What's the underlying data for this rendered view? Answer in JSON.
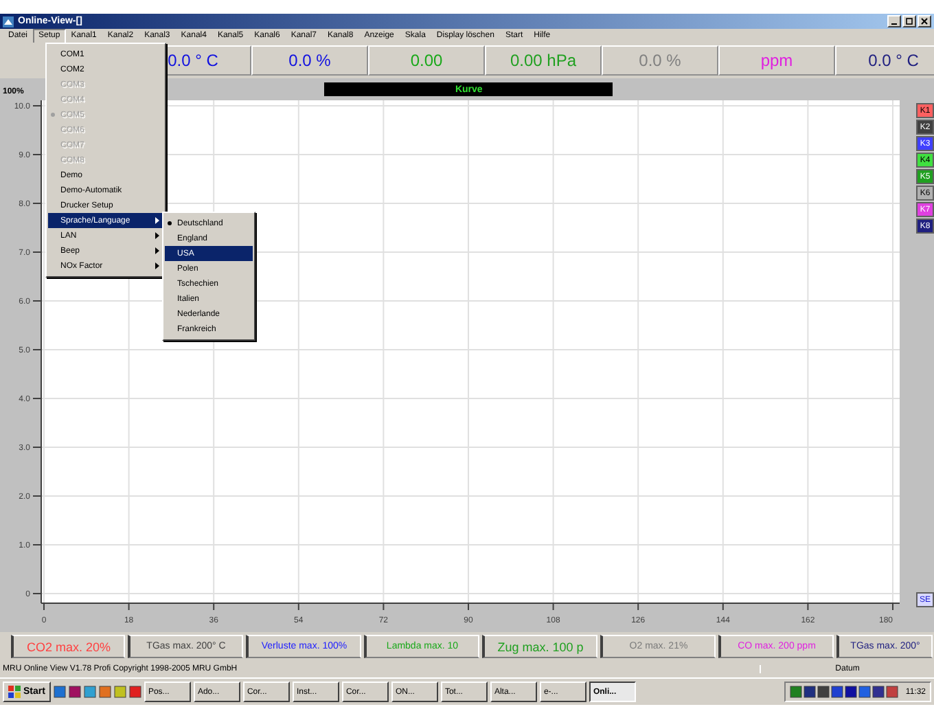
{
  "window": {
    "title": "Online-View-[]"
  },
  "menu_bar": [
    {
      "label": "Datei",
      "selected": false
    },
    {
      "label": "Setup",
      "selected": true
    },
    {
      "label": "Kanal1",
      "selected": false
    },
    {
      "label": "Kanal2",
      "selected": false
    },
    {
      "label": "Kanal3",
      "selected": false
    },
    {
      "label": "Kanal4",
      "selected": false
    },
    {
      "label": "Kanal5",
      "selected": false
    },
    {
      "label": "Kanal6",
      "selected": false
    },
    {
      "label": "Kanal7",
      "selected": false
    },
    {
      "label": "Kanal8",
      "selected": false
    },
    {
      "label": "Anzeige",
      "selected": false
    },
    {
      "label": "Skala",
      "selected": false
    },
    {
      "label": "Display löschen",
      "selected": false
    },
    {
      "label": "Start",
      "selected": false
    },
    {
      "label": "Hilfe",
      "selected": false
    }
  ],
  "readings": [
    {
      "value": "0.0 ° C",
      "color": "#1010e0"
    },
    {
      "value": "0.0 %",
      "color": "#1010e0"
    },
    {
      "value": "0.00",
      "color": "#18a818"
    },
    {
      "value": "0.00 hPa",
      "color": "#20a020"
    },
    {
      "value": "0.0 %",
      "color": "#808080"
    },
    {
      "value": "ppm",
      "color": "#e020e0"
    },
    {
      "value": "0.0 ° C",
      "color": "#202080"
    }
  ],
  "chart": {
    "scale_label": "100%",
    "title": "Kurve",
    "chart_data": {
      "type": "line",
      "grid": true,
      "xlim": [
        0,
        180
      ],
      "ylim": [
        0,
        10
      ],
      "xticks": [
        0,
        18,
        36,
        54,
        72,
        90,
        108,
        126,
        144,
        162,
        180
      ],
      "yticks": [
        {
          "value": 0,
          "label": "0"
        },
        {
          "value": 1,
          "label": "1.0"
        },
        {
          "value": 2,
          "label": "2.0"
        },
        {
          "value": 3,
          "label": "3.0"
        },
        {
          "value": 4,
          "label": "4.0"
        },
        {
          "value": 5,
          "label": "5.0"
        },
        {
          "value": 6,
          "label": "6.0"
        },
        {
          "value": 7,
          "label": "7.0"
        },
        {
          "value": 8,
          "label": "8.0"
        },
        {
          "value": 9,
          "label": "9.0"
        },
        {
          "value": 10,
          "label": "10.0"
        }
      ]
    }
  },
  "channel_buttons": [
    {
      "label": "K1",
      "color": "#ff6060"
    },
    {
      "label": "K2",
      "color": "#404040"
    },
    {
      "label": "K3",
      "color": "#4040ff"
    },
    {
      "label": "K4",
      "color": "#40e040"
    },
    {
      "label": "K5",
      "color": "#20a020"
    },
    {
      "label": "K6",
      "color": "#b0b0b0"
    },
    {
      "label": "K7",
      "color": "#e040e0"
    },
    {
      "label": "K8",
      "color": "#202080"
    }
  ],
  "se_button": "SE",
  "max_values": [
    {
      "label": "CO2 max. 20%",
      "color": "#ff4040"
    },
    {
      "label": "TGas max. 200° C",
      "color": "#404040"
    },
    {
      "label": "Verluste max. 100%",
      "color": "#2020ff"
    },
    {
      "label": "Lambda max. 10",
      "color": "#18a818"
    },
    {
      "label": "Zug max. 100 p",
      "color": "#20a020"
    },
    {
      "label": "O2 max. 21%",
      "color": "#7a7a7a"
    },
    {
      "label": "CO max. 200 ppm",
      "color": "#e020e0"
    },
    {
      "label": "TGas max. 200°",
      "color": "#202080"
    }
  ],
  "status_bar": {
    "text": "MRU Online View V1.78 Profi Copyright 1998-2005 MRU GmbH",
    "date_label": "Datum"
  },
  "setup_menu": [
    {
      "label": "COM1",
      "disabled": false,
      "checked": false,
      "has_submenu": false,
      "selected": false
    },
    {
      "label": "COM2",
      "disabled": false,
      "checked": false,
      "has_submenu": false,
      "selected": false
    },
    {
      "label": "COM3",
      "disabled": true,
      "checked": false,
      "has_submenu": false,
      "selected": false
    },
    {
      "label": "COM4",
      "disabled": true,
      "checked": false,
      "has_submenu": false,
      "selected": false
    },
    {
      "label": "COM5",
      "disabled": true,
      "checked": true,
      "has_submenu": false,
      "selected": false
    },
    {
      "label": "COM6",
      "disabled": true,
      "checked": false,
      "has_submenu": false,
      "selected": false
    },
    {
      "label": "COM7",
      "disabled": true,
      "checked": false,
      "has_submenu": false,
      "selected": false
    },
    {
      "label": "COM8",
      "disabled": true,
      "checked": false,
      "has_submenu": false,
      "selected": false
    },
    {
      "label": "Demo",
      "disabled": false,
      "checked": false,
      "has_submenu": false,
      "selected": false
    },
    {
      "label": "Demo-Automatik",
      "disabled": false,
      "checked": false,
      "has_submenu": false,
      "selected": false
    },
    {
      "label": "Drucker Setup",
      "disabled": false,
      "checked": false,
      "has_submenu": false,
      "selected": false
    },
    {
      "label": "Sprache/Language",
      "disabled": false,
      "checked": false,
      "has_submenu": true,
      "selected": true
    },
    {
      "label": "LAN",
      "disabled": false,
      "checked": false,
      "has_submenu": true,
      "selected": false
    },
    {
      "label": "Beep",
      "disabled": false,
      "checked": false,
      "has_submenu": true,
      "selected": false
    },
    {
      "label": "NOx Factor",
      "disabled": false,
      "checked": false,
      "has_submenu": true,
      "selected": false
    }
  ],
  "language_submenu": [
    {
      "label": "Deutschland",
      "checked": true,
      "selected": false
    },
    {
      "label": "England",
      "checked": false,
      "selected": false
    },
    {
      "label": "USA",
      "checked": false,
      "selected": true
    },
    {
      "label": "Polen",
      "checked": false,
      "selected": false
    },
    {
      "label": "Tschechien",
      "checked": false,
      "selected": false
    },
    {
      "label": "Italien",
      "checked": false,
      "selected": false
    },
    {
      "label": "Nederlande",
      "checked": false,
      "selected": false
    },
    {
      "label": "Frankreich",
      "checked": false,
      "selected": false
    }
  ],
  "taskbar": {
    "start": "Start",
    "clock": "11:32",
    "tasks": [
      {
        "label": "Pos...",
        "selected": false
      },
      {
        "label": "Ado...",
        "selected": false
      },
      {
        "label": "Cor...",
        "selected": false
      },
      {
        "label": "Inst...",
        "selected": false
      },
      {
        "label": "Cor...",
        "selected": false
      },
      {
        "label": "ON...",
        "selected": false
      },
      {
        "label": "Tot...",
        "selected": false
      },
      {
        "label": "Alta...",
        "selected": false
      },
      {
        "label": "e-...",
        "selected": false
      },
      {
        "label": "Onli...",
        "selected": true
      }
    ]
  }
}
